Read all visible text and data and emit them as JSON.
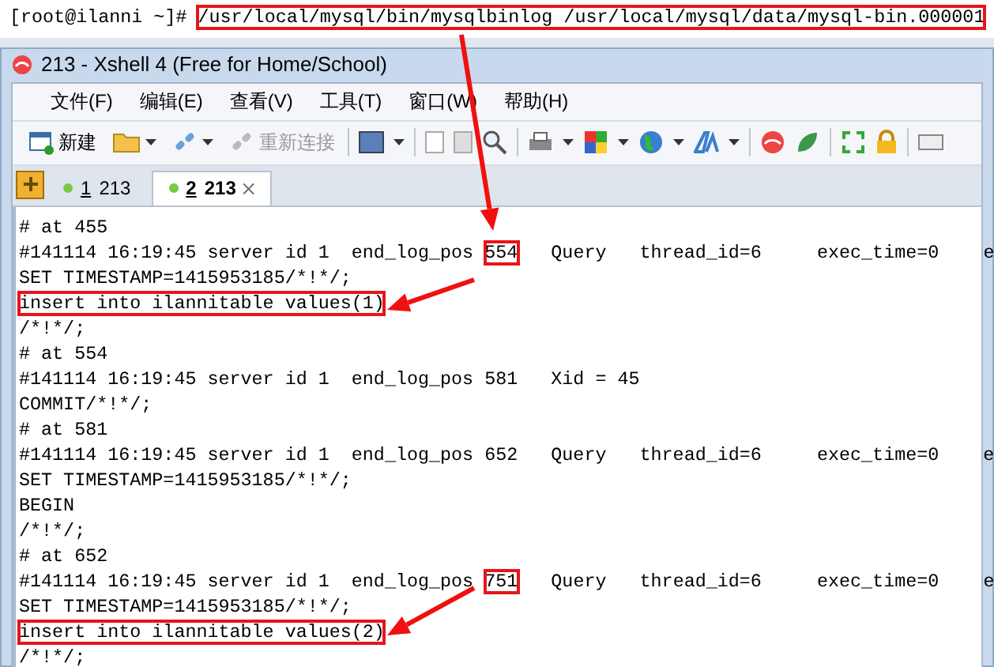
{
  "prompt_line": [
    {
      "text": "[root@ilanni ~]# ",
      "boxed": false
    },
    {
      "text": "/usr/local/mysql/bin/mysqlbinlog /usr/local/mysql/data/mysql-bin.000001",
      "boxed": true
    }
  ],
  "window": {
    "title": "213 - Xshell 4 (Free for Home/School)"
  },
  "menu": [
    "文件(F)",
    "编辑(E)",
    "查看(V)",
    "工具(T)",
    "窗口(W)",
    "帮助(H)"
  ],
  "toolbar": [
    {
      "kind": "new",
      "label": "新建",
      "disabled": false
    },
    {
      "kind": "open",
      "disabled": false
    },
    {
      "kind": "link",
      "disabled": false
    },
    {
      "kind": "reconnect",
      "label": "重新连接",
      "disabled": true
    }
  ],
  "tabs": [
    {
      "number": "1",
      "label": "213",
      "selected": false
    },
    {
      "number": "2",
      "label": "213",
      "selected": true
    }
  ],
  "terminal_lines": [
    [
      {
        "text": "# at 455",
        "boxed": false
      }
    ],
    [
      {
        "text": "#141114 16:19:45 server id 1  end_log_pos ",
        "boxed": false
      },
      {
        "text": "554",
        "boxed": true
      },
      {
        "text": "   Query   thread_id=6     exec_time=0    e",
        "boxed": false
      }
    ],
    [
      {
        "text": "SET TIMESTAMP=1415953185/*!*/;",
        "boxed": false
      }
    ],
    [
      {
        "text": "insert into ilannitable values(1)",
        "boxed": true
      }
    ],
    [
      {
        "text": "/*!*/;",
        "boxed": false
      }
    ],
    [
      {
        "text": "# at 554",
        "boxed": false
      }
    ],
    [
      {
        "text": "#141114 16:19:45 server id 1  end_log_pos 581   Xid = 45",
        "boxed": false
      }
    ],
    [
      {
        "text": "COMMIT/*!*/;",
        "boxed": false
      }
    ],
    [
      {
        "text": "# at 581",
        "boxed": false
      }
    ],
    [
      {
        "text": "#141114 16:19:45 server id 1  end_log_pos 652   Query   thread_id=6     exec_time=0    e",
        "boxed": false
      }
    ],
    [
      {
        "text": "SET TIMESTAMP=1415953185/*!*/;",
        "boxed": false
      }
    ],
    [
      {
        "text": "BEGIN",
        "boxed": false
      }
    ],
    [
      {
        "text": "/*!*/;",
        "boxed": false
      }
    ],
    [
      {
        "text": "# at 652",
        "boxed": false
      }
    ],
    [
      {
        "text": "#141114 16:19:45 server id 1  end_log_pos ",
        "boxed": false
      },
      {
        "text": "751",
        "boxed": true
      },
      {
        "text": "   Query   thread_id=6     exec_time=0    e",
        "boxed": false
      }
    ],
    [
      {
        "text": "SET TIMESTAMP=1415953185/*!*/;",
        "boxed": false
      }
    ],
    [
      {
        "text": "insert into ilannitable values(2)",
        "boxed": true
      }
    ],
    [
      {
        "text": "/*!*/;",
        "boxed": false
      }
    ]
  ]
}
